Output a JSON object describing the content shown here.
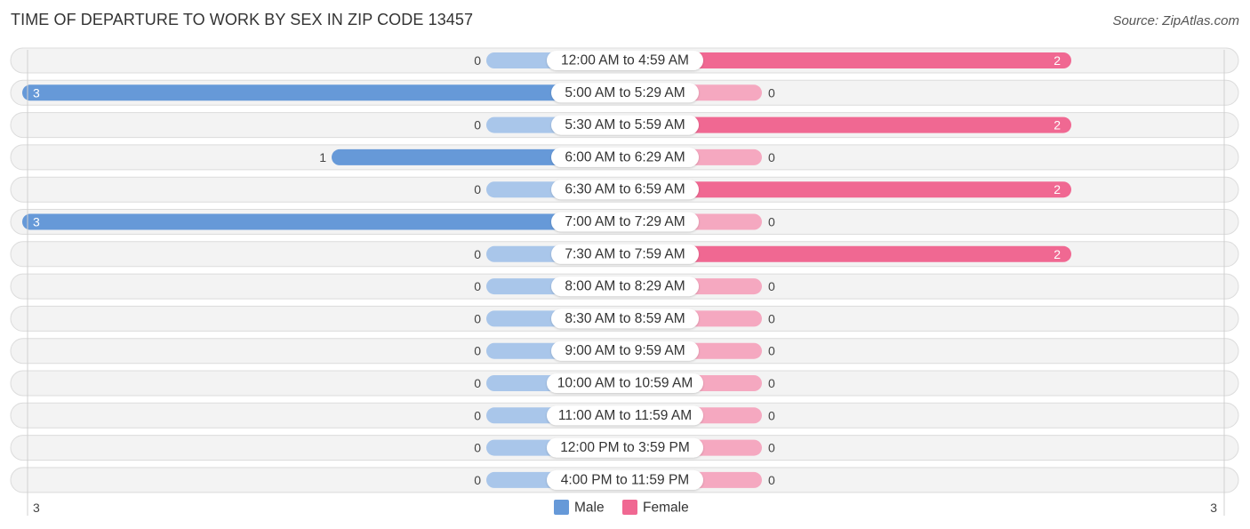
{
  "title": "TIME OF DEPARTURE TO WORK BY SEX IN ZIP CODE 13457",
  "source": "Source: ZipAtlas.com",
  "chart_data": {
    "type": "bar",
    "orientation": "horizontal-diverging",
    "title": "TIME OF DEPARTURE TO WORK BY SEX IN ZIP CODE 13457",
    "categories": [
      "12:00 AM to 4:59 AM",
      "5:00 AM to 5:29 AM",
      "5:30 AM to 5:59 AM",
      "6:00 AM to 6:29 AM",
      "6:30 AM to 6:59 AM",
      "7:00 AM to 7:29 AM",
      "7:30 AM to 7:59 AM",
      "8:00 AM to 8:29 AM",
      "8:30 AM to 8:59 AM",
      "9:00 AM to 9:59 AM",
      "10:00 AM to 10:59 AM",
      "11:00 AM to 11:59 AM",
      "12:00 PM to 3:59 PM",
      "4:00 PM to 11:59 PM"
    ],
    "series": [
      {
        "name": "Male",
        "color": "#6699d8",
        "light_color": "#a9c6ea",
        "values": [
          0,
          3,
          0,
          1,
          0,
          3,
          0,
          0,
          0,
          0,
          0,
          0,
          0,
          0
        ]
      },
      {
        "name": "Female",
        "color": "#f06892",
        "light_color": "#f5a8c0",
        "values": [
          2,
          0,
          2,
          0,
          2,
          0,
          2,
          0,
          0,
          0,
          0,
          0,
          0,
          0
        ]
      }
    ],
    "axis": {
      "left_tick_label": "3",
      "right_tick_label": "3",
      "max": 3
    },
    "legend": {
      "position": "bottom-center",
      "items": [
        "Male",
        "Female"
      ]
    }
  }
}
